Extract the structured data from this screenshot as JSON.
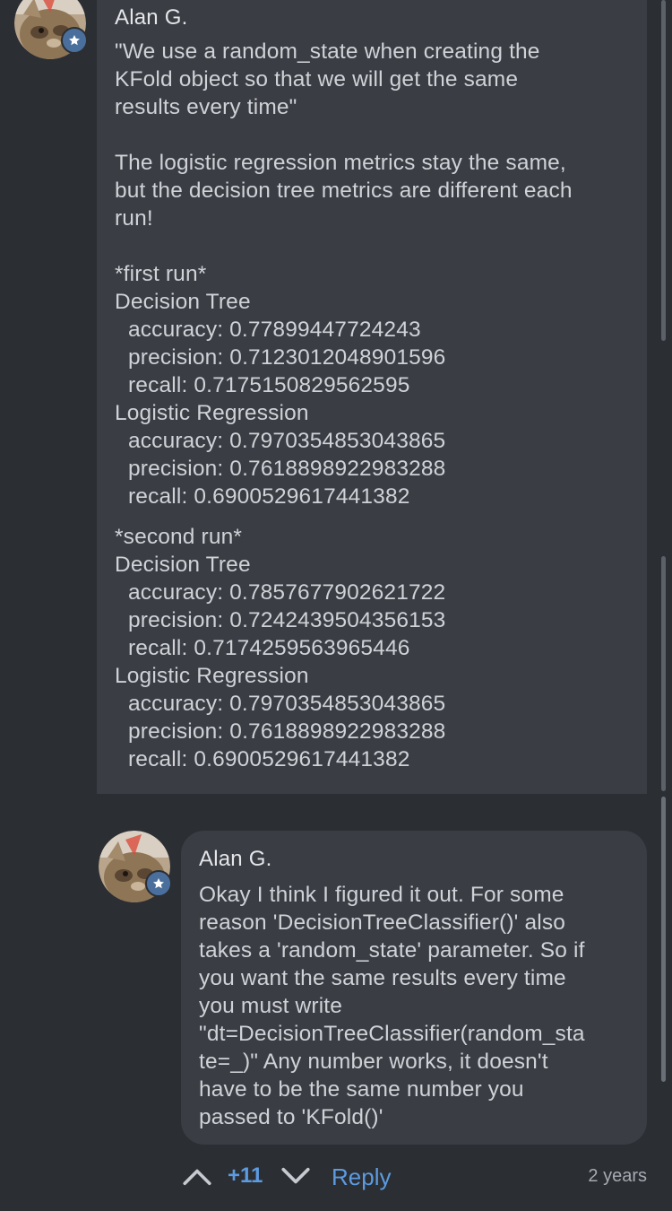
{
  "comments": [
    {
      "author": "Alan G.",
      "body": "\"We use a random_state when creating the\nKFold object so that we will get the same\nresults every time\"\n\nThe logistic regression metrics stay the same,\nbut the decision tree metrics are different each\nrun!",
      "runs": [
        {
          "heading": "*first run*",
          "models": [
            {
              "name": "Decision Tree",
              "accuracy": "accuracy: 0.77899447724243",
              "precision": "precision: 0.7123012048901596",
              "recall": "recall: 0.7175150829562595"
            },
            {
              "name": "Logistic Regression",
              "accuracy": "accuracy: 0.7970354853043865",
              "precision": "precision: 0.7618898922983288",
              "recall": "recall: 0.6900529617441382"
            }
          ]
        },
        {
          "heading": "*second run*",
          "models": [
            {
              "name": "Decision Tree",
              "accuracy": "accuracy: 0.7857677902621722",
              "precision": "precision: 0.7242439504356153",
              "recall": "recall: 0.7174259563965446"
            },
            {
              "name": "Logistic Regression",
              "accuracy": "accuracy: 0.7970354853043865",
              "precision": "precision: 0.7618898922983288",
              "recall": "recall: 0.6900529617441382"
            }
          ]
        }
      ]
    },
    {
      "author": "Alan G.",
      "body": "Okay I think I figured it out. For some\nreason 'DecisionTreeClassifier()' also\ntakes a 'random_state' parameter. So if\nyou want the same results every time\nyou must write\n\"dt=DecisionTreeClassifier(random_sta\nte=_)\" Any number works, it doesn't\nhave to be the same number you\npassed to 'KFold()'"
    }
  ],
  "actions": {
    "score": "+11",
    "reply_label": "Reply",
    "timestamp": "2 years"
  },
  "icons": {
    "avatar_badge": "star-icon",
    "upvote": "chevron-up-icon",
    "downvote": "chevron-down-icon"
  },
  "colors": {
    "background": "#2b2e33",
    "bubble": "#3a3d43",
    "accent": "#5c9be0",
    "badge": "#4b6f9c"
  }
}
